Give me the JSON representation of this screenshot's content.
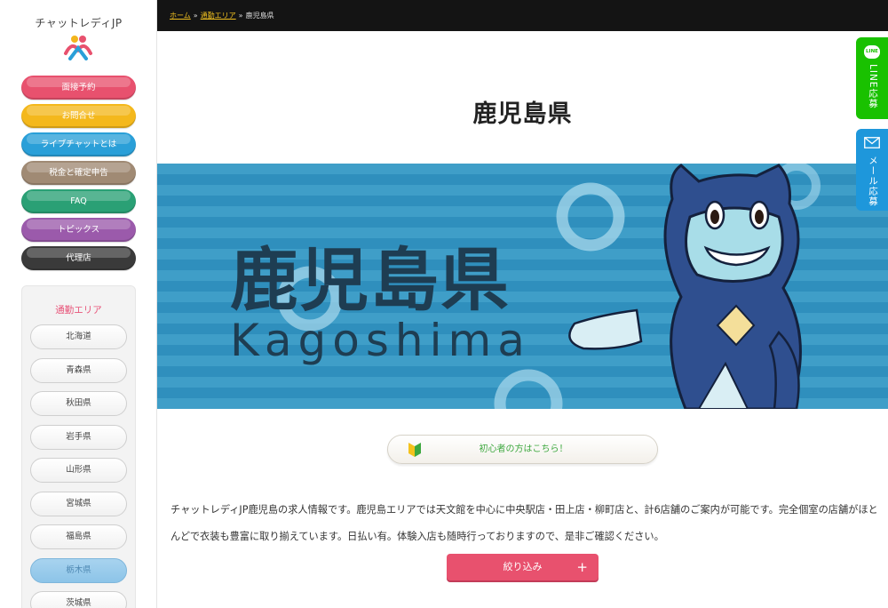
{
  "sidebar": {
    "logo_text": "チャットレディJP",
    "menu": [
      {
        "label": "面接予約",
        "color": "#e8516e"
      },
      {
        "label": "お問合せ",
        "color": "#f4b81c"
      },
      {
        "label": "ライブチャットとは",
        "color": "#2a9fd8"
      },
      {
        "label": "税金と確定申告",
        "color": "#a08a74"
      },
      {
        "label": "FAQ",
        "color": "#2aa075"
      },
      {
        "label": "トピックス",
        "color": "#9b5aab"
      },
      {
        "label": "代理店",
        "color": "#3a3a3a"
      }
    ],
    "area_title": "通勤エリア",
    "areas": [
      "北海道",
      "青森県",
      "秋田県",
      "岩手県",
      "山形県",
      "宮城県",
      "福島県",
      "栃木県",
      "茨城県"
    ],
    "active_area": "栃木県"
  },
  "breadcrumb": {
    "home": "ホーム",
    "area": "通勤エリア",
    "current": "鹿児島県",
    "separator": "»"
  },
  "page_title": "鹿児島県",
  "hero": {
    "title_jp": "鹿児島県",
    "title_en": "Kagoshima"
  },
  "beginner_label": "初心者の方はこちら！",
  "intro_text": "チャットレディJP鹿児島の求人情報です。鹿児島エリアでは天文館を中心に中央駅店・田上店・柳町店と、計6店舗のご案内が可能です。完全個室の店舗がほとんどで衣装も豊富に取り揃えています。日払い有。体験入店も随時行っておりますので、是非ご確認ください。",
  "filter_label": "絞り込み",
  "filter_plus": "+",
  "side_tabs": {
    "line_badge": "LINE",
    "line_label": "LINE応募",
    "mail_label": "メール応募"
  }
}
